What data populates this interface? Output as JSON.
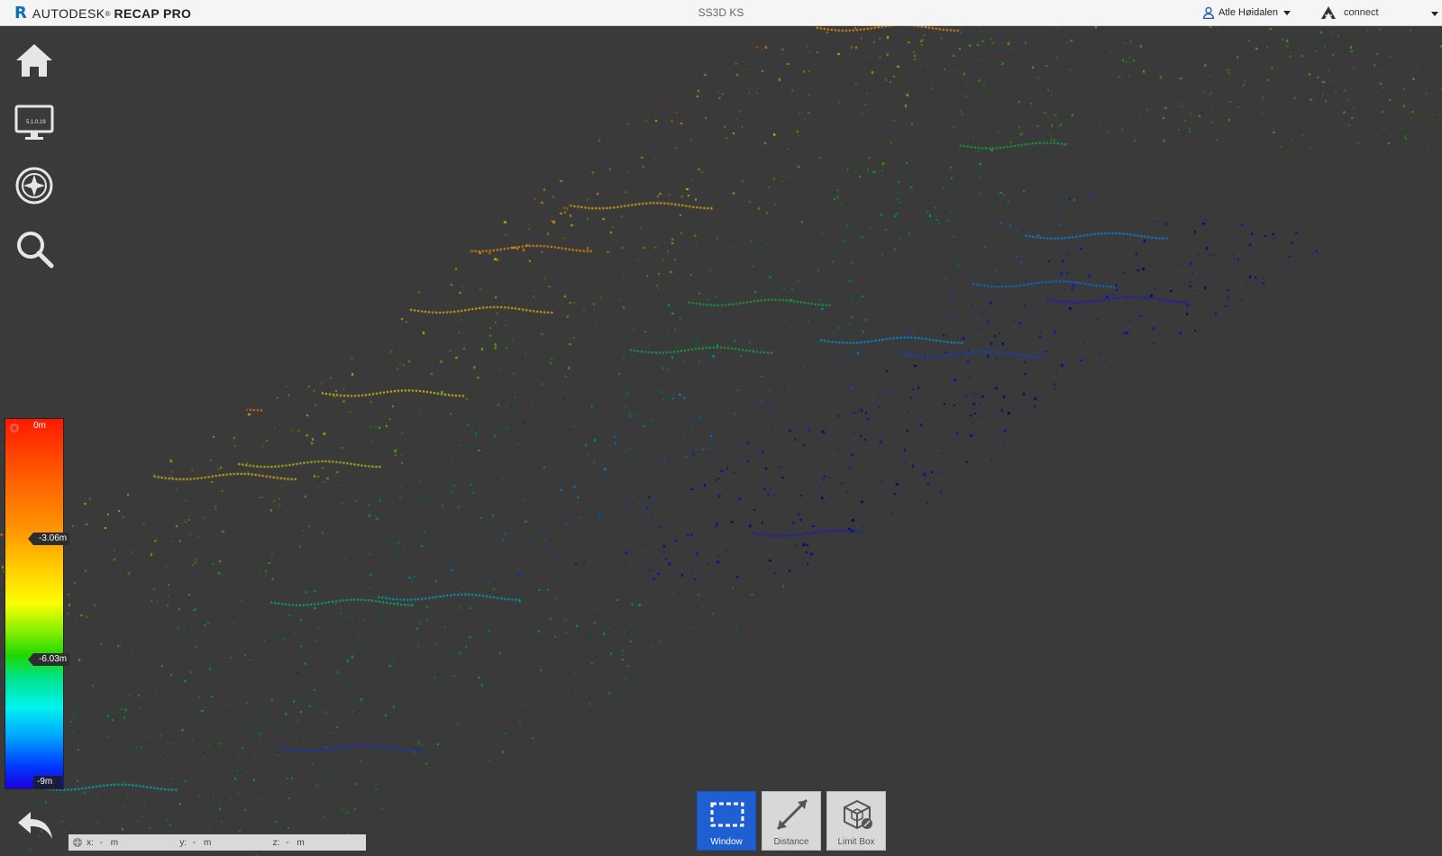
{
  "app": {
    "brand_logo": "R",
    "brand_company": "AUTODESK",
    "brand_registered": "®",
    "brand_product": "RECAP PRO",
    "document_title": "SS3D KS"
  },
  "header": {
    "user_name": "Atle Høidalen",
    "user_icon": "user-icon",
    "connect_label": "connect",
    "connect_icon": "autodesk-a-icon"
  },
  "nav": {
    "items": [
      {
        "name": "home",
        "icon": "home-icon"
      },
      {
        "name": "display",
        "icon": "monitor-icon",
        "badge": "5.1.0.19"
      },
      {
        "name": "navigate",
        "icon": "compass-icon"
      },
      {
        "name": "search",
        "icon": "magnifier-icon"
      }
    ]
  },
  "legend": {
    "settings_icon": "gear-icon",
    "top_label": "0m",
    "mid_labels": [
      "-3.06m",
      "-6.03m"
    ],
    "bottom_label": "-9m",
    "colors": [
      "#ff1a00",
      "#ff9500",
      "#f9ff00",
      "#1fd800",
      "#00f4ee",
      "#0038ff",
      "#1d00e0"
    ]
  },
  "status": {
    "icon": "coordinate-icon",
    "x_label": "x:",
    "x_value": "-",
    "y_label": "y:",
    "y_value": "-",
    "z_label": "z:",
    "z_value": "-",
    "unit": "m"
  },
  "toolbar": {
    "back_icon": "back-arrow-icon",
    "tools": [
      {
        "label": "Window",
        "icon": "window-select-icon",
        "active": true
      },
      {
        "label": "Distance",
        "icon": "measure-distance-icon",
        "active": false
      },
      {
        "label": "Limit Box",
        "icon": "limit-box-icon",
        "active": false
      }
    ]
  },
  "colors": {
    "titlebar": "#f5f5f5",
    "viewport_bg": "#3a3a3a",
    "active_tool": "#1e5fd2",
    "brand_blue": "#0b6fb5"
  }
}
